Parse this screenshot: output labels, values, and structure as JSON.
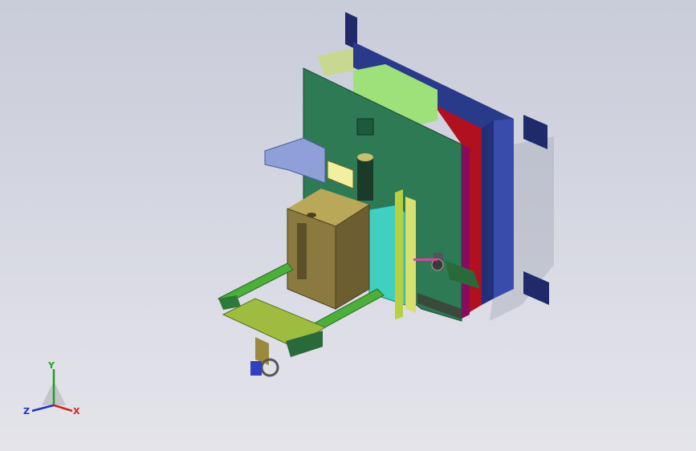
{
  "viewport": {
    "background_top": "#c9ccd9",
    "background_bottom": "#e4e4ea"
  },
  "triad": {
    "x_label": "X",
    "y_label": "Y",
    "z_label": "Z",
    "x_color": "#d32020",
    "y_color": "#20a020",
    "z_color": "#2030c0"
  },
  "model": {
    "colors": {
      "green_plate": "#2d7a55",
      "lime_block": "#9ee07a",
      "red_panel": "#b01020",
      "navy_frame": "#2a3a8a",
      "cyan_plate": "#40d0c0",
      "khaki_box": "#8a7a40",
      "rail_green": "#4caf3a",
      "yellow_green": "#b8d040"
    },
    "icon": "cad-assembly-model"
  }
}
